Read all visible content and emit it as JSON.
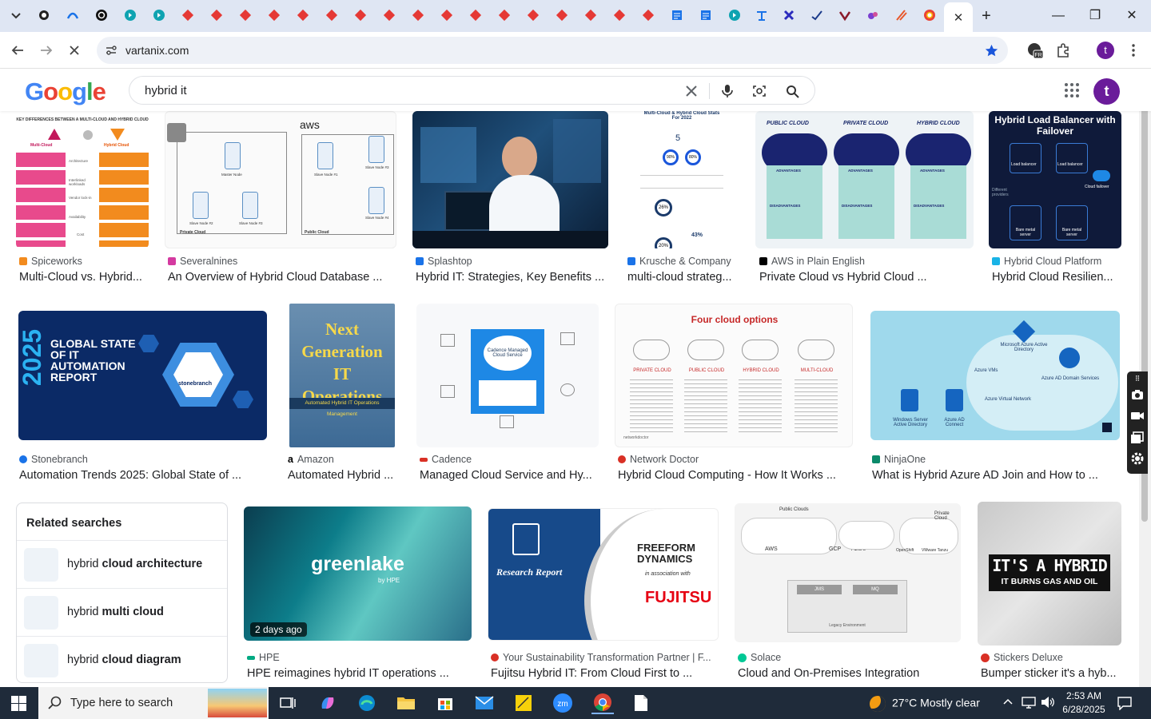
{
  "browser": {
    "url": "vartanix.com",
    "close_tab_glyph": "✕",
    "new_tab_glyph": "+",
    "window_min": "—",
    "window_max": "❐",
    "window_close": "✕"
  },
  "google": {
    "logo": "Google",
    "query": "hybrid it",
    "avatar_letter": "t"
  },
  "profile_letter": "t",
  "results": [
    {
      "source": "Spiceworks",
      "title": "Multi-Cloud vs. Hybrid...",
      "fav_color": "#f28b1e",
      "thumb_text": [
        "KEY DIFFERENCES BETWEEN A MULTI-CLOUD AND HYBRID CLOUD",
        "Multi-Cloud",
        "Hybrid Cloud",
        "Architecture",
        "Interlinked workloads",
        "Vendor lock-in",
        "Availability",
        "Cost"
      ]
    },
    {
      "source": "Severalnines",
      "title": "An Overview of Hybrid Cloud Database ...",
      "fav_color": "#d43aa0",
      "thumb_text": [
        "aws",
        "Private Cloud",
        "Public Cloud",
        "Master Node",
        "Slave Node #1",
        "Slave Node #2",
        "Slave Node #3",
        "Slave Node #4"
      ]
    },
    {
      "source": "Splashtop",
      "title": "Hybrid IT: Strategies, Key Benefits ...",
      "fav_color": "#1a73e8",
      "thumb_text": []
    },
    {
      "source": "Krusche & Company",
      "title": "multi-cloud strateg...",
      "fav_color": "#1a73e8",
      "thumb_text": [
        "Multi-Cloud & Hybrid Cloud Stats For 2022",
        "5",
        "90%",
        "80%",
        "26%",
        "43%",
        "20%"
      ]
    },
    {
      "source": "AWS in Plain English",
      "title": "Private Cloud vs Hybrid Cloud ...",
      "fav_color": "#000000",
      "thumb_text": [
        "PUBLIC CLOUD",
        "PRIVATE CLOUD",
        "HYBRID CLOUD",
        "ADVANTAGES",
        "DISADVANTAGES"
      ]
    },
    {
      "source": "Hybrid Cloud Platform",
      "title": "Hybrid Cloud Resilien...",
      "fav_color": "#19b3e6",
      "thumb_text": [
        "Hybrid Load Balancer with Failover",
        "Load balancer",
        "Load balancer",
        "Different providers",
        "Cloud failover",
        "Bare metal server",
        "Bare metal server"
      ]
    },
    {
      "source": "Stonebranch",
      "title": "Automation Trends 2025: Global State of ...",
      "fav_color": "#1a73e8",
      "thumb_text": [
        "2025",
        "GLOBAL STATE OF IT AUTOMATION REPORT",
        "stonebranch"
      ]
    },
    {
      "source": "Amazon",
      "title": "Automated Hybrid ...",
      "fav_color": "#222222",
      "thumb_text": [
        "Next Generation IT Operations",
        "Automated Hybrid IT Operations Management"
      ]
    },
    {
      "source": "Cadence",
      "title": "Managed Cloud Service and Hy...",
      "fav_color": "#d93025",
      "thumb_text": [
        "Cadence Managed Cloud Service"
      ]
    },
    {
      "source": "Network Doctor",
      "title": "Hybrid Cloud Computing - How It Works ...",
      "fav_color": "#d93025",
      "thumb_text": [
        "Four cloud options",
        "PRIVATE CLOUD",
        "PUBLIC CLOUD",
        "HYBRID CLOUD",
        "MULTI-CLOUD",
        "networkdoctor"
      ]
    },
    {
      "source": "NinjaOne",
      "title": "What is Hybrid Azure AD Join and How to ...",
      "fav_color": "#0b8a6a",
      "thumb_text": [
        "Microsoft Azure Active Directory",
        "Azure VMs",
        "Azure AD Domain Services",
        "Azure Virtual Network",
        "Windows Server Active Directory",
        "Azure AD Connect"
      ]
    },
    {
      "source": "HPE",
      "title": "HPE reimagines hybrid IT operations ...",
      "fav_color": "#01a982",
      "thumb_text": [
        "greenlake",
        "by HPE",
        "2 days ago"
      ]
    },
    {
      "source": "Your Sustainability Transformation Partner | F...",
      "title": "Fujitsu Hybrid IT: From Cloud First to ...",
      "fav_color": "#d93025",
      "thumb_text": [
        "Research Report",
        "FREEFORM DYNAMICS",
        "in association with",
        "FUJITSU"
      ]
    },
    {
      "source": "Solace",
      "title": "Cloud and On-Premises Integration",
      "fav_color": "#00c895",
      "thumb_text": [
        "Public Clouds",
        "Private Cloud",
        "AWS",
        "GCP",
        "Azure",
        "OpenShift",
        "VMware Tanzu",
        "JMS",
        "MQ",
        "Legacy Environment"
      ]
    },
    {
      "source": "Stickers Deluxe",
      "title": "Bumper sticker it's a hyb...",
      "fav_color": "#d93025",
      "thumb_text": [
        "IT'S A HYBRID",
        "IT BURNS GAS AND OIL"
      ]
    }
  ],
  "related": {
    "heading": "Related searches",
    "items": [
      {
        "prefix": "hybrid ",
        "bold": "cloud architecture"
      },
      {
        "prefix": "hybrid ",
        "bold": "multi cloud"
      },
      {
        "prefix": "hybrid ",
        "bold": "cloud diagram"
      }
    ]
  },
  "taskbar": {
    "search_placeholder": "Type here to search",
    "weather": "27°C  Mostly clear",
    "time": "2:53 AM",
    "date": "6/28/2025"
  }
}
